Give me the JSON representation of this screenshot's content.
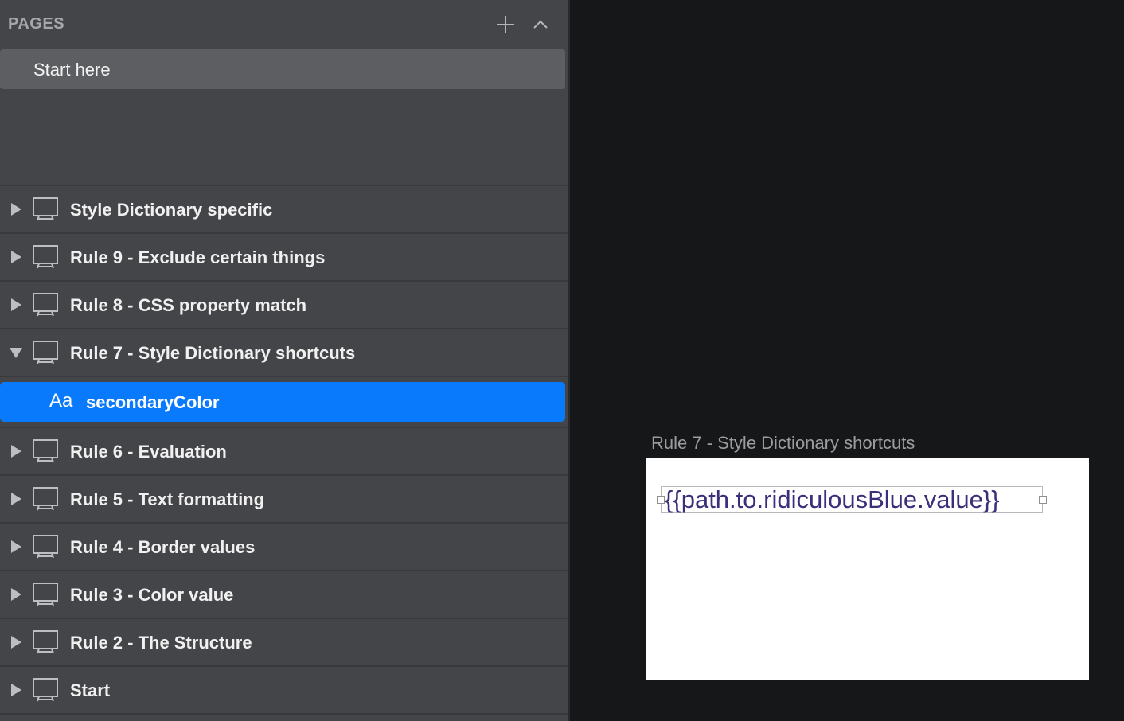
{
  "sidebar": {
    "pages_title": "PAGES",
    "add_page_icon": "plus-icon",
    "collapse_icon": "chevron-up-icon",
    "pages": [
      {
        "label": "Start here",
        "selected": true
      }
    ],
    "layers": [
      {
        "label": "Style Dictionary specific",
        "expanded": false
      },
      {
        "label": "Rule 9 - Exclude certain things",
        "expanded": false
      },
      {
        "label": "Rule 8 - CSS property match",
        "expanded": false
      },
      {
        "label": "Rule 7 - Style Dictionary shortcuts",
        "expanded": true
      },
      {
        "label": "Rule 6 - Evaluation",
        "expanded": false
      },
      {
        "label": "Rule 5 - Text formatting",
        "expanded": false
      },
      {
        "label": "Rule 4 - Border values",
        "expanded": false
      },
      {
        "label": "Rule 3 - Color value",
        "expanded": false
      },
      {
        "label": "Rule 2 - The Structure",
        "expanded": false
      },
      {
        "label": "Start",
        "expanded": false
      }
    ],
    "expanded_child": {
      "icon_text": "Aa",
      "label": "secondaryColor",
      "selected": true
    }
  },
  "canvas": {
    "artboard_title": "Rule 7 - Style Dictionary shortcuts",
    "text_layer_value": "{{path.to.ridiculousBlue.value}}"
  },
  "colors": {
    "sidebar_bg": "#444548",
    "canvas_bg": "#161719",
    "selection_blue": "#0a7afd",
    "text_layer_color": "#3a2f7a"
  }
}
